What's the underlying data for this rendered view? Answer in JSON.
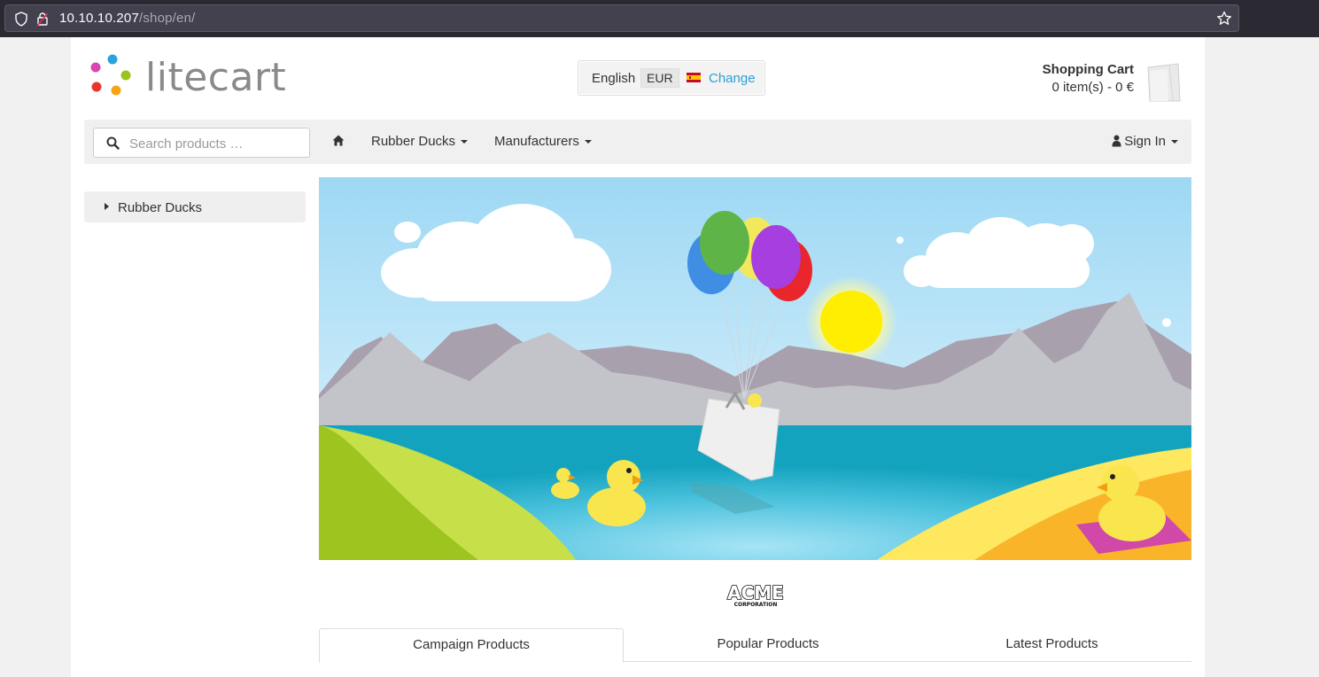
{
  "browser": {
    "url_host": "10.10.10.207",
    "url_path": "/shop/en/"
  },
  "header": {
    "logo_text": "litecart",
    "region": {
      "language": "English",
      "currency": "EUR",
      "change_label": "Change"
    },
    "cart": {
      "title": "Shopping Cart",
      "summary": "0 item(s) - 0 €"
    }
  },
  "navbar": {
    "search_placeholder": "Search products …",
    "items": [
      {
        "label": "Rubber Ducks"
      },
      {
        "label": "Manufacturers"
      }
    ],
    "signin_label": "Sign In"
  },
  "sidebar": {
    "categories": [
      {
        "label": "Rubber Ducks"
      }
    ]
  },
  "brand": {
    "logo_text": "ACME",
    "logo_subtext": "CORPORATION"
  },
  "tabs": [
    {
      "label": "Campaign Products",
      "active": true
    },
    {
      "label": "Popular Products",
      "active": false
    },
    {
      "label": "Latest Products",
      "active": false
    }
  ],
  "colors": {
    "link": "#2b9fd9",
    "navbar_bg": "#f0f0f0",
    "sky": "#a9dff5",
    "water": "#1aa6c2"
  }
}
